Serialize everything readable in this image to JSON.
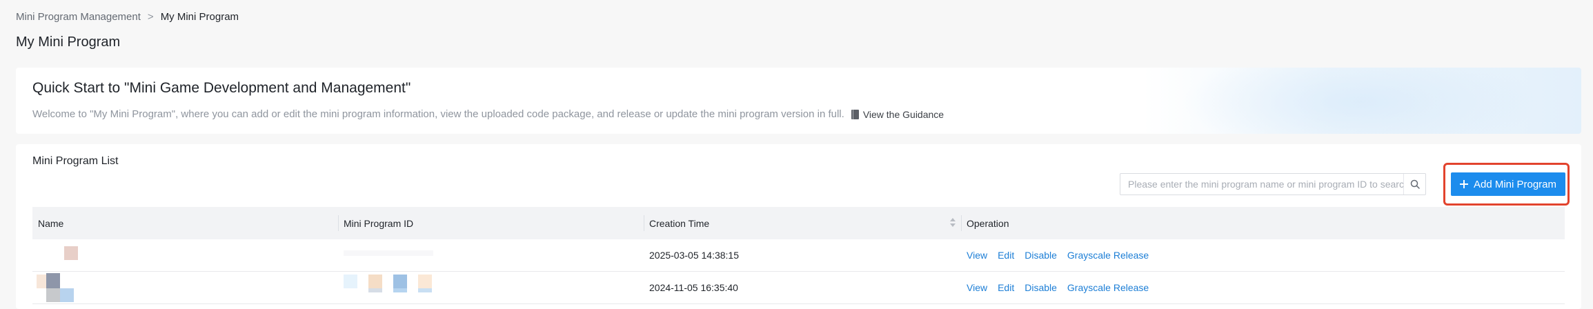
{
  "breadcrumb": {
    "parent": "Mini Program Management",
    "separator": ">",
    "current": "My Mini Program"
  },
  "page_title": "My Mini Program",
  "quick_start": {
    "title": "Quick Start to \"Mini Game Development and Management\"",
    "description": "Welcome to \"My Mini Program\", where you can add or edit the mini program information, view the uploaded code package, and release or update the mini program version in full.",
    "guide_icon": "book-icon",
    "guide_link": "View the Guidance"
  },
  "list": {
    "title": "Mini Program List",
    "search_placeholder": "Please enter the mini program name or mini program ID to search",
    "search_value": "",
    "search_icon": "search-icon",
    "add_button": "Add Mini Program",
    "highlight_color": "#e2432d",
    "columns": [
      "Name",
      "Mini Program ID",
      "Creation Time",
      "Operation"
    ],
    "rows": [
      {
        "creation_time": "2025-03-05 14:38:15",
        "operations": [
          "View",
          "Edit",
          "Disable",
          "Grayscale Release"
        ]
      },
      {
        "creation_time": "2024-11-05 16:35:40",
        "operations": [
          "View",
          "Edit",
          "Disable",
          "Grayscale Release"
        ]
      }
    ]
  },
  "colors": {
    "accent": "#1c8ced",
    "link": "#1c7ed6",
    "background": "#f7f7f7"
  }
}
